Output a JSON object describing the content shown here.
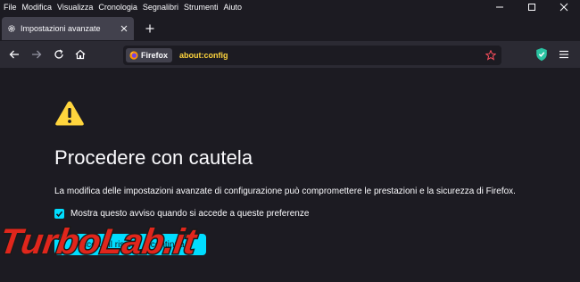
{
  "menu": {
    "items": [
      "File",
      "Modifica",
      "Visualizza",
      "Cronologia",
      "Segnalibri",
      "Strumenti",
      "Aiuto"
    ]
  },
  "tab": {
    "title": "Impostazioni avanzate",
    "icon": "gear-icon"
  },
  "urlbar": {
    "identity_label": "Firefox",
    "url": "about:config"
  },
  "content": {
    "heading": "Procedere con cautela",
    "description": "La modifica delle impostazioni avanzate di configurazione può compromettere le prestazioni e la sicurezza di Firefox.",
    "checkbox_label": "Mostra questo avviso quando si accede a queste preferenze",
    "checkbox_checked": true,
    "accept_button_label": "Accetta il rischio e continua"
  },
  "watermark": {
    "text": "TurboLab.it"
  },
  "colors": {
    "accent": "#00ddff",
    "warning": "#ffd53d",
    "background": "#1c1b22",
    "toolbar": "#2b2a33",
    "watermark_red": "#e0261c"
  }
}
